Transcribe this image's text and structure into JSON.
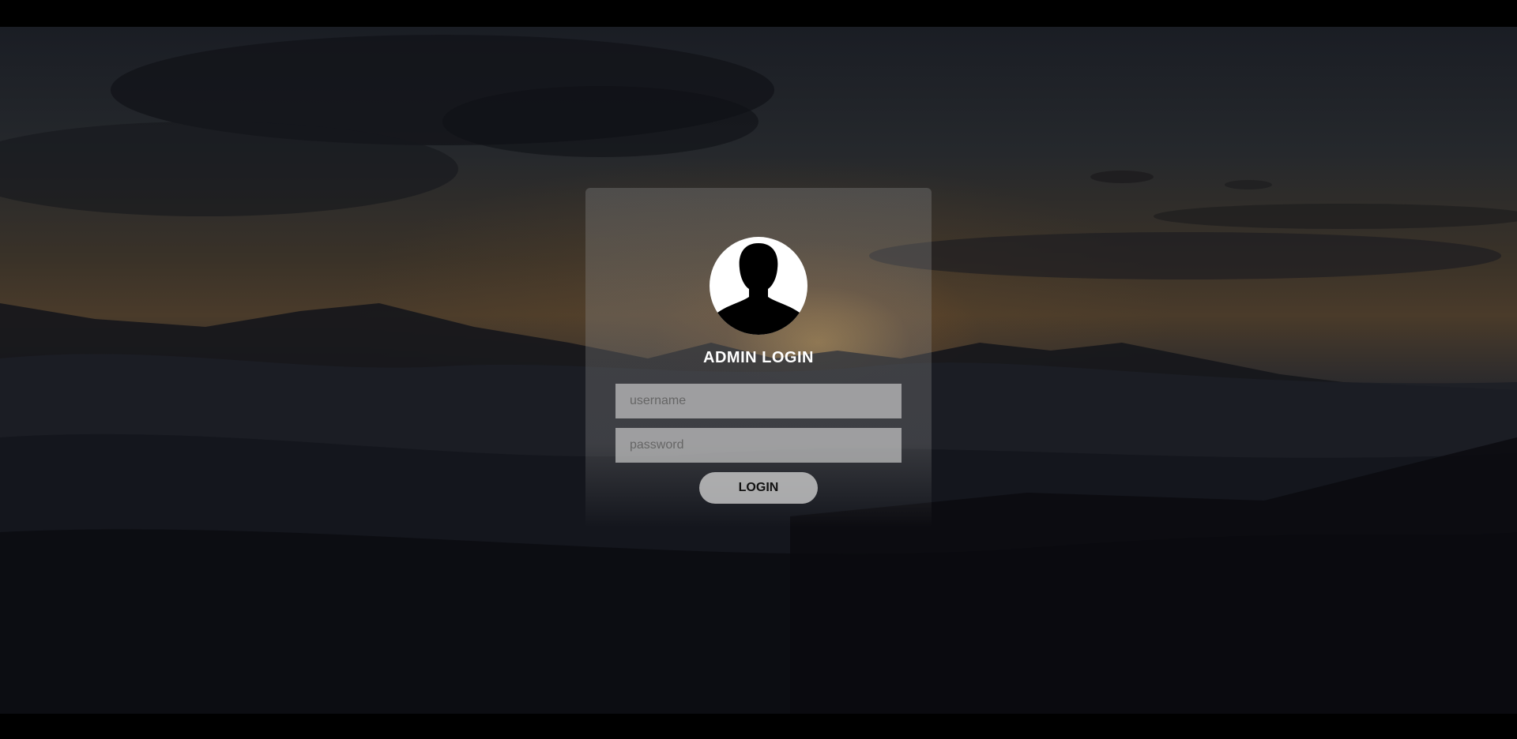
{
  "login": {
    "title": "ADMIN LOGIN",
    "username_placeholder": "username",
    "password_placeholder": "password",
    "username_value": "",
    "password_value": "",
    "button_label": "LOGIN"
  },
  "icons": {
    "avatar": "user-silhouette-icon"
  }
}
